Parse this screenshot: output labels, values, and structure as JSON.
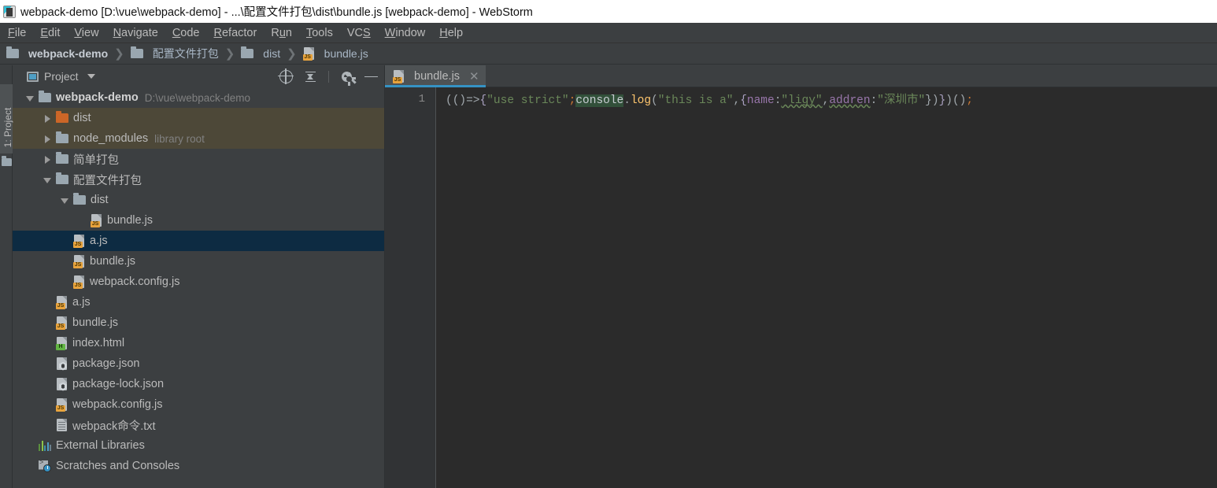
{
  "window": {
    "title": "webpack-demo [D:\\vue\\webpack-demo] - ...\\配置文件打包\\dist\\bundle.js [webpack-demo] - WebStorm",
    "app_icon": "webstorm-icon"
  },
  "menubar": {
    "items": [
      {
        "label": "File",
        "mnemonic": "F"
      },
      {
        "label": "Edit",
        "mnemonic": "E"
      },
      {
        "label": "View",
        "mnemonic": "V"
      },
      {
        "label": "Navigate",
        "mnemonic": "N"
      },
      {
        "label": "Code",
        "mnemonic": "C"
      },
      {
        "label": "Refactor",
        "mnemonic": "R"
      },
      {
        "label": "Run",
        "mnemonic": "u"
      },
      {
        "label": "Tools",
        "mnemonic": "T"
      },
      {
        "label": "VCS",
        "mnemonic": "S"
      },
      {
        "label": "Window",
        "mnemonic": "W"
      },
      {
        "label": "Help",
        "mnemonic": "H"
      }
    ]
  },
  "breadcrumb": {
    "separator": "❯",
    "items": [
      {
        "label": "webpack-demo",
        "icon": "folder-icon",
        "bold": true
      },
      {
        "label": "配置文件打包",
        "icon": "folder-icon",
        "bold": false
      },
      {
        "label": "dist",
        "icon": "folder-icon",
        "bold": false
      },
      {
        "label": "bundle.js",
        "icon": "js-file-icon",
        "bold": false
      }
    ]
  },
  "toolstrip": {
    "project_button_label": "1: Project"
  },
  "project_panel": {
    "title": "Project",
    "tools": [
      {
        "name": "locate-icon",
        "tooltip": "Select Opened File"
      },
      {
        "name": "collapse-all-icon",
        "tooltip": "Collapse All"
      },
      {
        "name": "gear-icon",
        "tooltip": "Settings"
      },
      {
        "name": "minimize-icon",
        "tooltip": "Hide"
      }
    ],
    "tree": [
      {
        "label": "webpack-demo",
        "sub": "D:\\vue\\webpack-demo",
        "icon": "folder-icon",
        "arrow": "down",
        "indent": 0,
        "bold": true,
        "state": "normal"
      },
      {
        "label": "dist",
        "sub": "",
        "icon": "folder-orange-icon",
        "arrow": "right",
        "indent": 1,
        "bold": false,
        "state": "excluded"
      },
      {
        "label": "node_modules",
        "sub": "library root",
        "icon": "folder-icon",
        "arrow": "right",
        "indent": 1,
        "bold": false,
        "state": "excluded"
      },
      {
        "label": "简单打包",
        "sub": "",
        "icon": "folder-icon",
        "arrow": "right",
        "indent": 1,
        "bold": false,
        "state": "normal"
      },
      {
        "label": "配置文件打包",
        "sub": "",
        "icon": "folder-icon",
        "arrow": "down",
        "indent": 1,
        "bold": false,
        "state": "normal"
      },
      {
        "label": "dist",
        "sub": "",
        "icon": "folder-icon",
        "arrow": "down",
        "indent": 2,
        "bold": false,
        "state": "normal"
      },
      {
        "label": "bundle.js",
        "sub": "",
        "icon": "js-file-icon",
        "arrow": "none",
        "indent": 3,
        "bold": false,
        "state": "normal"
      },
      {
        "label": "a.js",
        "sub": "",
        "icon": "js-file-icon",
        "arrow": "none",
        "indent": 2,
        "bold": false,
        "state": "selected"
      },
      {
        "label": "bundle.js",
        "sub": "",
        "icon": "js-file-icon",
        "arrow": "none",
        "indent": 2,
        "bold": false,
        "state": "normal"
      },
      {
        "label": "webpack.config.js",
        "sub": "",
        "icon": "js-file-icon",
        "arrow": "none",
        "indent": 2,
        "bold": false,
        "state": "normal"
      },
      {
        "label": "a.js",
        "sub": "",
        "icon": "js-file-icon",
        "arrow": "none",
        "indent": 1,
        "bold": false,
        "state": "normal"
      },
      {
        "label": "bundle.js",
        "sub": "",
        "icon": "js-file-icon",
        "arrow": "none",
        "indent": 1,
        "bold": false,
        "state": "normal"
      },
      {
        "label": "index.html",
        "sub": "",
        "icon": "html-file-icon",
        "arrow": "none",
        "indent": 1,
        "bold": false,
        "state": "normal"
      },
      {
        "label": "package.json",
        "sub": "",
        "icon": "json-node-file-icon",
        "arrow": "none",
        "indent": 1,
        "bold": false,
        "state": "normal"
      },
      {
        "label": "package-lock.json",
        "sub": "",
        "icon": "json-node-file-icon",
        "arrow": "none",
        "indent": 1,
        "bold": false,
        "state": "normal"
      },
      {
        "label": "webpack.config.js",
        "sub": "",
        "icon": "js-file-icon",
        "arrow": "none",
        "indent": 1,
        "bold": false,
        "state": "normal"
      },
      {
        "label": "webpack命令.txt",
        "sub": "",
        "icon": "txt-file-icon",
        "arrow": "none",
        "indent": 1,
        "bold": false,
        "state": "normal"
      },
      {
        "label": "External Libraries",
        "sub": "",
        "icon": "libraries-icon",
        "arrow": "none",
        "indent": 0,
        "bold": false,
        "state": "normal"
      },
      {
        "label": "Scratches and Consoles",
        "sub": "",
        "icon": "scratches-icon",
        "arrow": "none",
        "indent": 0,
        "bold": false,
        "state": "normal"
      }
    ]
  },
  "editor": {
    "tabs": [
      {
        "label": "bundle.js",
        "icon": "js-file-icon",
        "active": true,
        "close": "✕"
      }
    ],
    "line_numbers": [
      "1"
    ],
    "code_tokens": [
      {
        "text": "(()",
        "type": "punct"
      },
      {
        "text": "=>",
        "type": "arrow"
      },
      {
        "text": "{",
        "type": "brace"
      },
      {
        "text": "\"use strict\"",
        "type": "string"
      },
      {
        "text": ";",
        "type": "semi"
      },
      {
        "text": "console",
        "type": "ident"
      },
      {
        "text": ".",
        "type": "punct"
      },
      {
        "text": "log",
        "type": "fn"
      },
      {
        "text": "(",
        "type": "punct"
      },
      {
        "text": "\"this is a\"",
        "type": "string"
      },
      {
        "text": ",",
        "type": "punct"
      },
      {
        "text": "{",
        "type": "brace"
      },
      {
        "text": "name",
        "type": "key"
      },
      {
        "text": ":",
        "type": "punct"
      },
      {
        "text": "\"ligy\"",
        "type": "string-squiggle"
      },
      {
        "text": ",",
        "type": "punct"
      },
      {
        "text": "addren",
        "type": "key-squiggle"
      },
      {
        "text": ":",
        "type": "punct"
      },
      {
        "text": "\"深圳市\"",
        "type": "string"
      },
      {
        "text": "})",
        "type": "punct"
      },
      {
        "text": "}",
        "type": "brace"
      },
      {
        "text": ")()",
        "type": "punct"
      },
      {
        "text": ";",
        "type": "semi"
      }
    ]
  },
  "colors": {
    "titlebar_bg": "#ffffff",
    "chrome_bg": "#3c3f41",
    "editor_bg": "#2b2b2b",
    "gutter_bg": "#313335",
    "selection_bg": "#0d2b42",
    "excluded_bg": "#4d4838",
    "tab_active_underline": "#3592c4",
    "string_green": "#6a8759",
    "function_amber": "#ffc66d",
    "keyword_orange": "#cc7832",
    "property_purple": "#9876aa",
    "js_badge": "#e8a33d",
    "html_badge": "#62b543",
    "folder_orange": "#cc6627"
  }
}
